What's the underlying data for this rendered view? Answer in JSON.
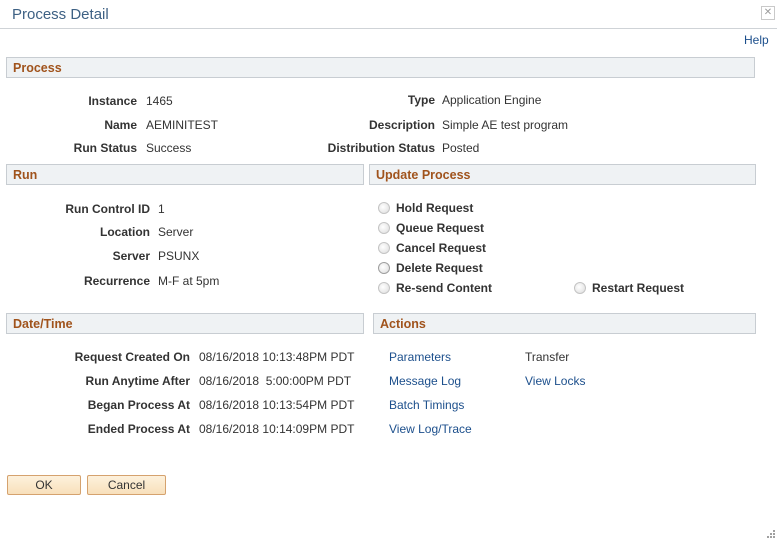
{
  "dialog": {
    "title": "Process Detail",
    "close_icon": "close-icon",
    "help_label": "Help"
  },
  "process": {
    "heading": "Process",
    "instance_label": "Instance",
    "instance": "1465",
    "name_label": "Name",
    "name": "AEMINITEST",
    "run_status_label": "Run Status",
    "run_status": "Success",
    "type_label": "Type",
    "type": "Application Engine",
    "description_label": "Description",
    "description": "Simple AE test program",
    "distribution_status_label": "Distribution Status",
    "distribution_status": "Posted"
  },
  "run": {
    "heading": "Run",
    "run_control_id_label": "Run Control ID",
    "run_control_id": "1",
    "location_label": "Location",
    "location": "Server",
    "server_label": "Server",
    "server": "PSUNX",
    "recurrence_label": "Recurrence",
    "recurrence": "M-F at 5pm"
  },
  "update_process": {
    "heading": "Update Process",
    "options": [
      "Hold Request",
      "Queue Request",
      "Cancel Request",
      "Delete Request",
      "Re-send Content",
      "Restart Request"
    ]
  },
  "datetime": {
    "heading": "Date/Time",
    "rows": [
      {
        "label": "Request Created On",
        "value": "08/16/2018 10:13:48PM PDT"
      },
      {
        "label": "Run Anytime After",
        "value": "08/16/2018  5:00:00PM PDT"
      },
      {
        "label": "Began Process At",
        "value": "08/16/2018 10:13:54PM PDT"
      },
      {
        "label": "Ended Process At",
        "value": "08/16/2018 10:14:09PM PDT"
      }
    ]
  },
  "actions": {
    "heading": "Actions",
    "parameters": "Parameters",
    "message_log": "Message Log",
    "batch_timings": "Batch Timings",
    "view_log_trace": "View Log/Trace",
    "transfer": "Transfer",
    "view_locks": "View Locks"
  },
  "buttons": {
    "ok": "OK",
    "cancel": "Cancel"
  }
}
